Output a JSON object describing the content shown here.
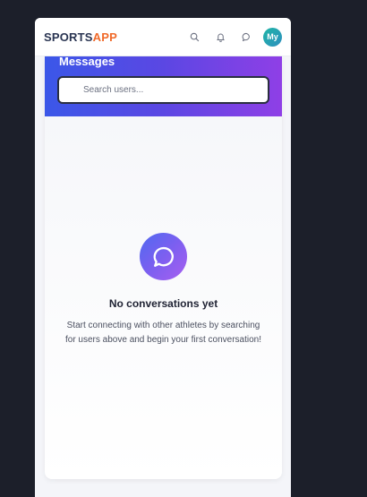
{
  "brand": {
    "part1": "SPORTS",
    "part2": "APP",
    "accent_color": "#f06a2a"
  },
  "topbar": {
    "icons": [
      "search-icon",
      "bell-icon",
      "chat-icon"
    ],
    "avatar_initials": "My"
  },
  "messages": {
    "title": "Messages",
    "search_placeholder": "Search users..."
  },
  "empty_state": {
    "icon": "chat-bubble-icon",
    "title": "No conversations yet",
    "description": "Start connecting with other athletes by searching for users above and begin your first conversation!"
  }
}
